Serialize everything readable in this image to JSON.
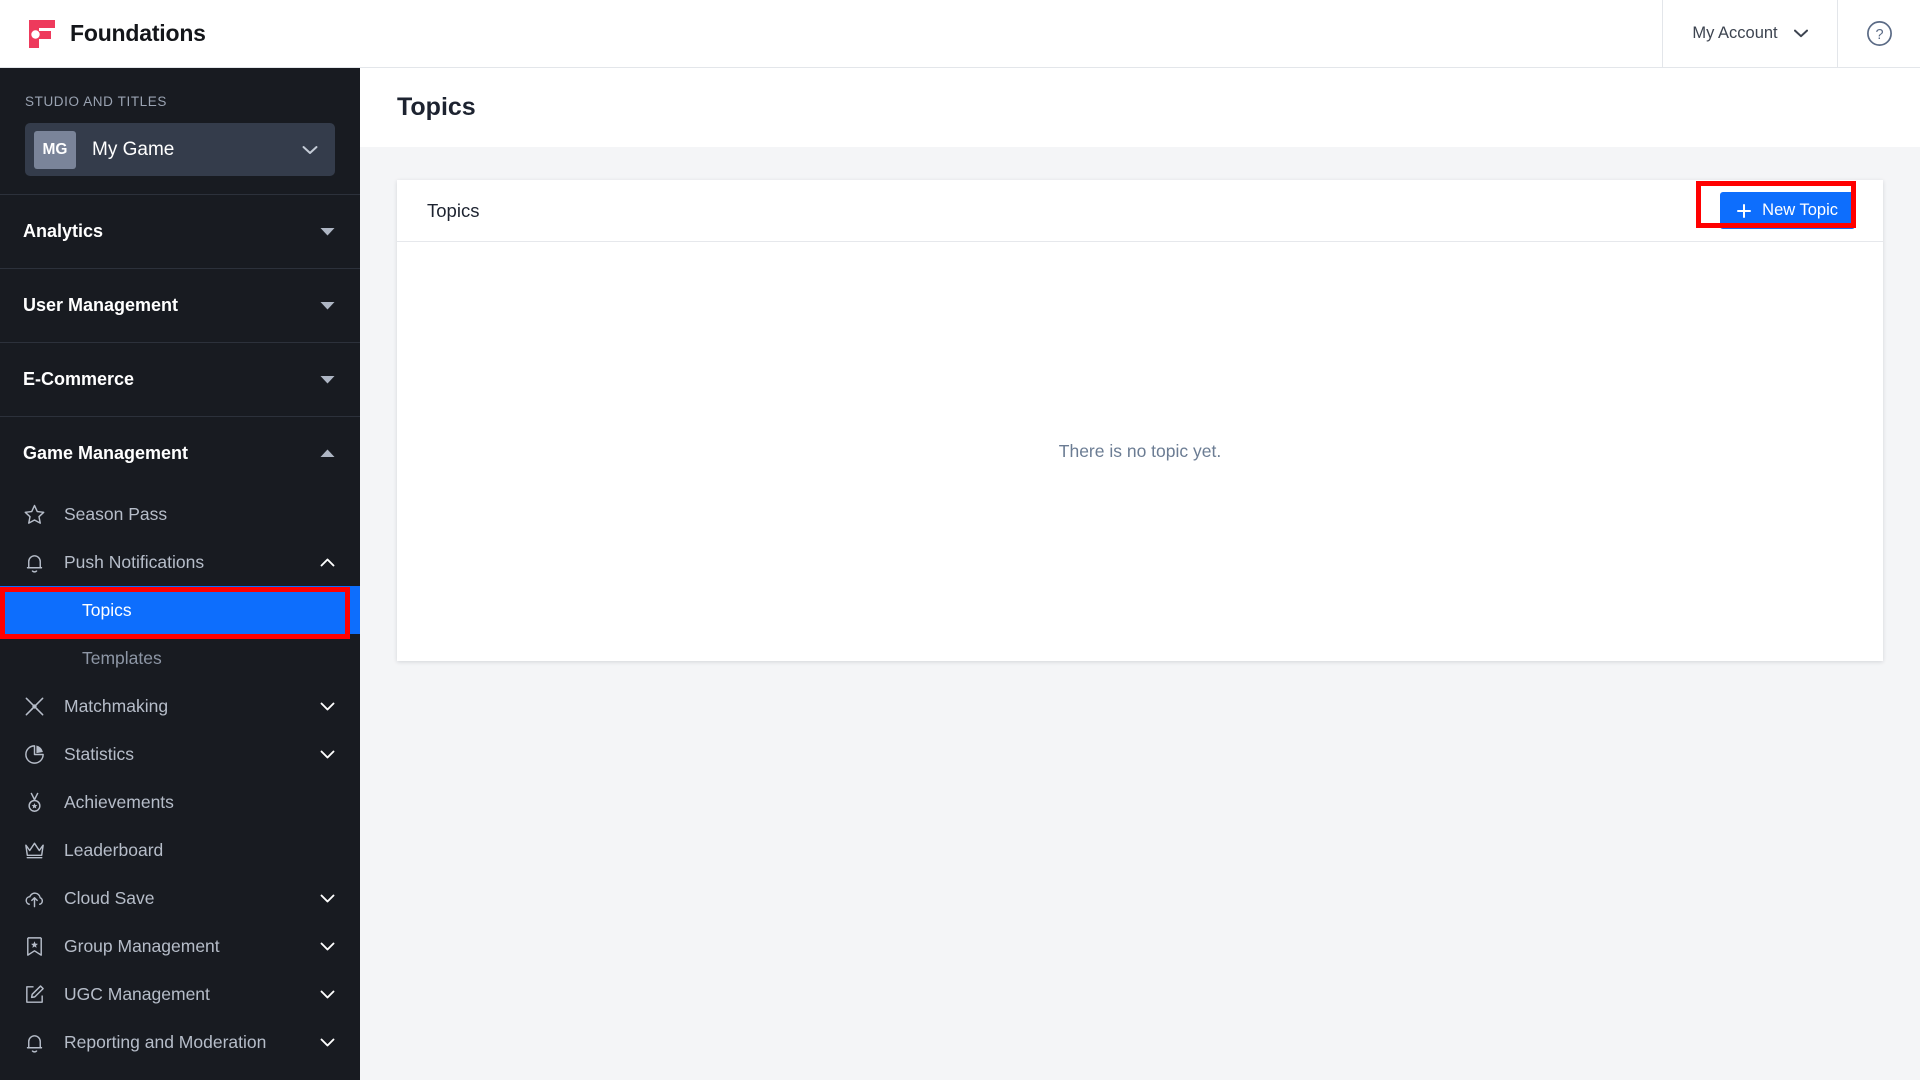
{
  "topbar": {
    "brand_name": "Foundations",
    "brand_logo_icon": "foundations-logo",
    "brand_color": "#ee3a5c",
    "account_label": "My Account",
    "account_chevron_icon": "chevron-down-icon",
    "help_icon": "question-circle-icon"
  },
  "sidebar": {
    "studio_label": "STUDIO AND TITLES",
    "studio": {
      "initials": "MG",
      "name": "My Game",
      "chevron_icon": "chevron-down-icon"
    },
    "groups": [
      {
        "label": "Analytics",
        "expanded": false,
        "triangle_icon": "triangle-down-icon"
      },
      {
        "label": "User Management",
        "expanded": false,
        "triangle_icon": "triangle-down-icon"
      },
      {
        "label": "E-Commerce",
        "expanded": false,
        "triangle_icon": "triangle-down-icon"
      },
      {
        "label": "Game Management",
        "expanded": true,
        "triangle_icon": "triangle-up-icon"
      }
    ],
    "items": [
      {
        "label": "Season Pass",
        "icon": "star-icon",
        "chevron": "none"
      },
      {
        "label": "Push Notifications",
        "icon": "bell-icon",
        "chevron": "chevron-up-icon"
      },
      {
        "label": "Matchmaking",
        "icon": "crossed-swords-icon",
        "chevron": "chevron-down-icon"
      },
      {
        "label": "Statistics",
        "icon": "pie-chart-icon",
        "chevron": "chevron-down-icon"
      },
      {
        "label": "Achievements",
        "icon": "medal-icon",
        "chevron": "none"
      },
      {
        "label": "Leaderboard",
        "icon": "crown-icon",
        "chevron": "none"
      },
      {
        "label": "Cloud Save",
        "icon": "cloud-upload-icon",
        "chevron": "chevron-down-icon"
      },
      {
        "label": "Group Management",
        "icon": "bookmark-star-icon",
        "chevron": "chevron-down-icon"
      },
      {
        "label": "UGC Management",
        "icon": "edit-square-icon",
        "chevron": "chevron-down-icon"
      },
      {
        "label": "Reporting and Moderation",
        "icon": "bell-icon",
        "chevron": "chevron-down-icon"
      }
    ],
    "subitems": [
      {
        "label": "Topics",
        "active": true
      },
      {
        "label": "Templates",
        "active": false
      }
    ],
    "active_color": "#0d6efd",
    "highlight_color": "#ff0000"
  },
  "main": {
    "page_title": "Topics",
    "card_title": "Topics",
    "new_topic_label": "New Topic",
    "new_topic_plus_icon": "plus-icon",
    "empty_state_text": "There is no topic yet."
  }
}
